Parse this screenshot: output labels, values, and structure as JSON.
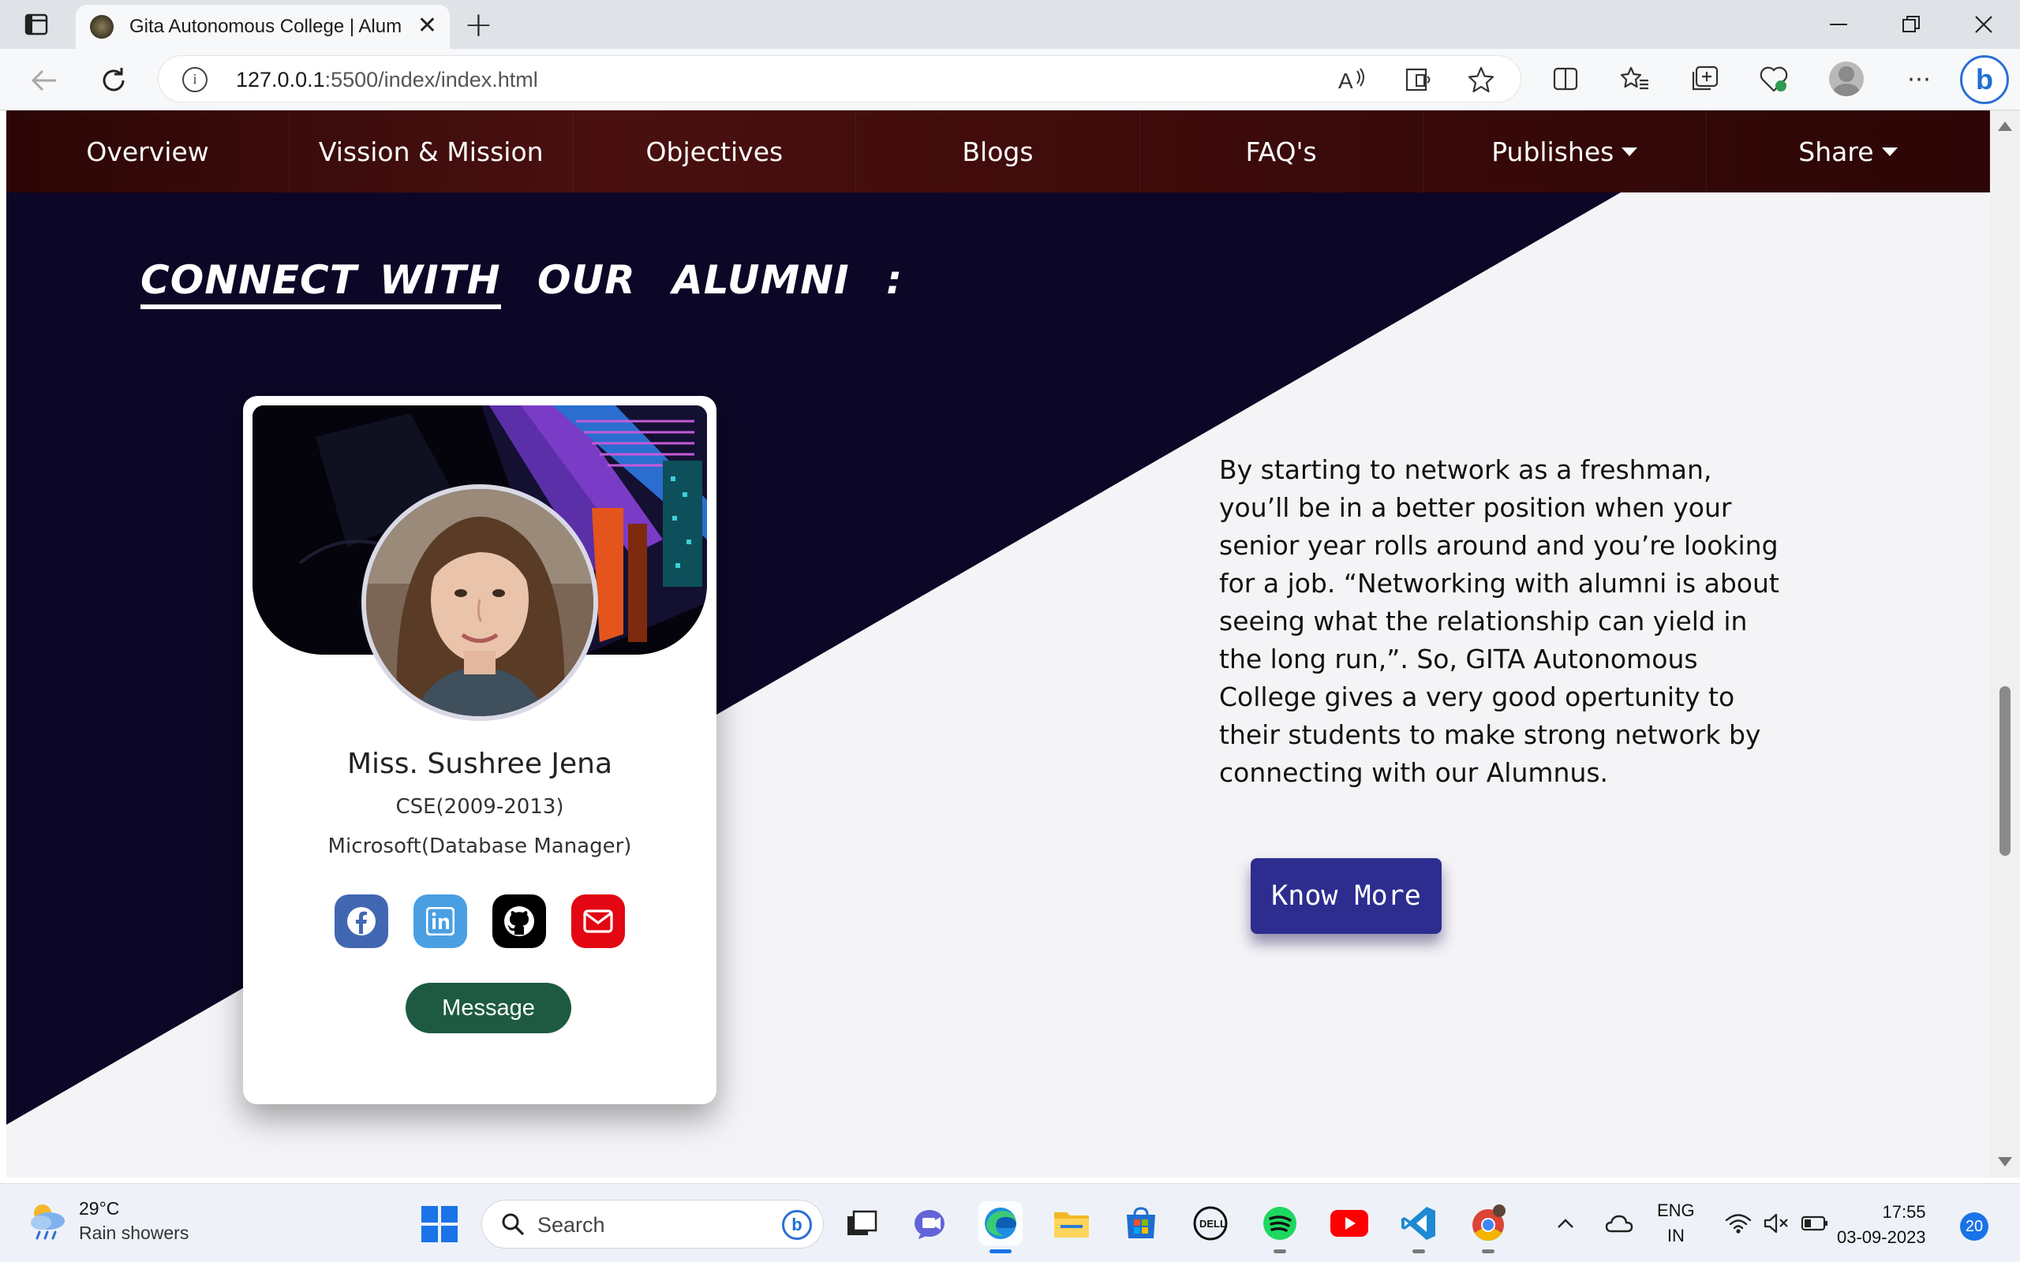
{
  "browser": {
    "tab_title": "Gita Autonomous College | Alum",
    "url_host": "127.0.0.1",
    "url_path": ":5500/index/index.html"
  },
  "nav": {
    "items": [
      "Overview",
      "Vission & Mission",
      "Objectives",
      "Blogs",
      "FAQ's"
    ],
    "publishes": "Publishes",
    "share": "Share"
  },
  "section": {
    "title_connect": "CONNECT",
    "title_with": "WITH",
    "title_our": "OUR",
    "title_alumni": "ALUMNI",
    "title_colon": ":"
  },
  "card": {
    "name": "Miss. Sushree Jena",
    "branch": "CSE(2009-2013)",
    "job": "Microsoft(Database Manager)",
    "message_label": "Message",
    "socials": [
      "facebook-icon",
      "linkedin-icon",
      "github-icon",
      "mail-icon"
    ]
  },
  "description": "By starting to network as a freshman, you’ll be in a better position when your senior year rolls around and you’re looking for a job. “Networking with alumni is about seeing what the relationship can yield in the long run,”. So, GITA Autonomous College gives a very good opertunity to their students to make strong network by connecting with our Alumnus.",
  "know_more_label": "Know More",
  "taskbar": {
    "weather_temp": "29°C",
    "weather_desc": "Rain showers",
    "search_placeholder": "Search",
    "lang_top": "ENG",
    "lang_bottom": "IN",
    "time": "17:55",
    "date": "03-09-2023",
    "notifications": "20"
  },
  "colors": {
    "nav_bg": "#3d0a0a",
    "dark_bg": "#0c0726",
    "light_bg": "#f4f3f6",
    "know_more": "#2d2d8f",
    "message_btn": "#1e5a42"
  }
}
